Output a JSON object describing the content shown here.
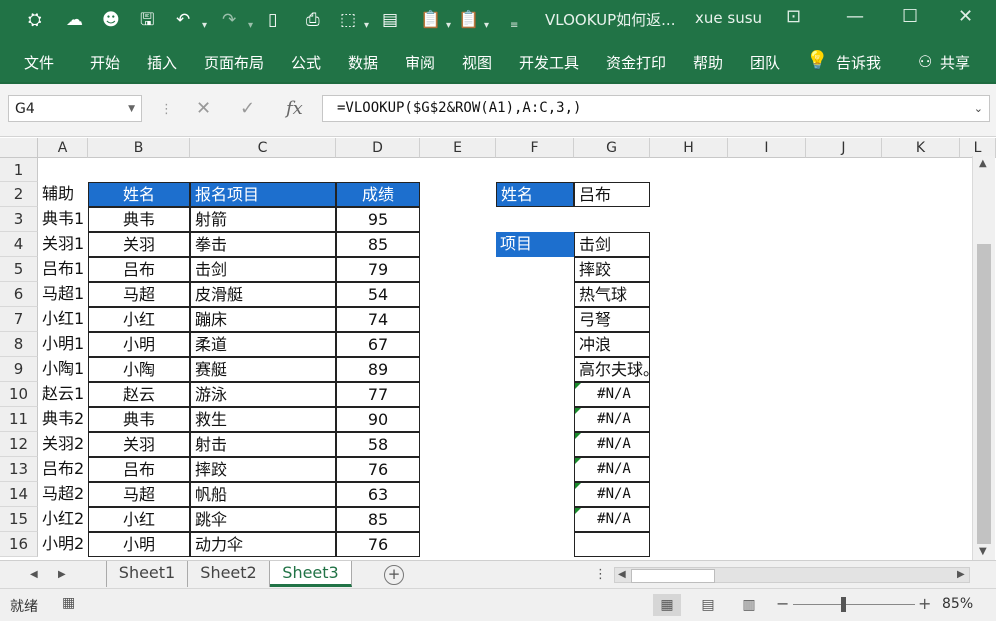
{
  "window": {
    "title": "VLOOKUP如何返...",
    "user": "xue susu"
  },
  "ribbon": {
    "tabs": [
      "文件",
      "开始",
      "插入",
      "页面布局",
      "公式",
      "数据",
      "审阅",
      "视图",
      "开发工具",
      "资金打印",
      "帮助",
      "团队"
    ],
    "tellme": "告诉我",
    "share": "共享"
  },
  "formula_bar": {
    "name_box": "G4",
    "formula": "=VLOOKUP($G$2&ROW(A1),A:C,3,)"
  },
  "columns": [
    "A",
    "B",
    "C",
    "D",
    "E",
    "F",
    "G",
    "H",
    "I",
    "J",
    "K",
    "L"
  ],
  "rows": [
    "1",
    "2",
    "3",
    "4",
    "5",
    "6",
    "7",
    "8",
    "9",
    "10",
    "11",
    "12",
    "13",
    "14",
    "15",
    "16"
  ],
  "table": {
    "helper_header": "辅助",
    "headers": [
      "姓名",
      "报名项目",
      "成绩"
    ],
    "rows": [
      {
        "helper": "典韦1",
        "name": "典韦",
        "event": "射箭",
        "score": "95"
      },
      {
        "helper": "关羽1",
        "name": "关羽",
        "event": "拳击",
        "score": "85"
      },
      {
        "helper": "吕布1",
        "name": "吕布",
        "event": "击剑",
        "score": "79"
      },
      {
        "helper": "马超1",
        "name": "马超",
        "event": "皮滑艇",
        "score": "54"
      },
      {
        "helper": "小红1",
        "name": "小红",
        "event": "蹦床",
        "score": "74"
      },
      {
        "helper": "小明1",
        "name": "小明",
        "event": "柔道",
        "score": "67"
      },
      {
        "helper": "小陶1",
        "name": "小陶",
        "event": "赛艇",
        "score": "89"
      },
      {
        "helper": "赵云1",
        "name": "赵云",
        "event": "游泳",
        "score": "77"
      },
      {
        "helper": "典韦2",
        "name": "典韦",
        "event": "救生",
        "score": "90"
      },
      {
        "helper": "关羽2",
        "name": "关羽",
        "event": "射击",
        "score": "58"
      },
      {
        "helper": "吕布2",
        "name": "吕布",
        "event": "摔跤",
        "score": "76"
      },
      {
        "helper": "马超2",
        "name": "马超",
        "event": "帆船",
        "score": "63"
      },
      {
        "helper": "小红2",
        "name": "小红",
        "event": "跳伞",
        "score": "85"
      },
      {
        "helper": "小明2",
        "name": "小明",
        "event": "动力伞",
        "score": "76"
      }
    ]
  },
  "lookup": {
    "name_label": "姓名",
    "name_value": "吕布",
    "item_label": "项目",
    "results": [
      "击剑",
      "摔跤",
      "热气球",
      "弓弩",
      "冲浪",
      "高尔夫球。",
      "#N/A",
      "#N/A",
      "#N/A",
      "#N/A",
      "#N/A",
      "#N/A",
      ""
    ]
  },
  "sheets": {
    "tabs": [
      "Sheet1",
      "Sheet2",
      "Sheet3"
    ],
    "active": "Sheet3"
  },
  "status": {
    "ready": "就绪",
    "zoom": "85%"
  }
}
